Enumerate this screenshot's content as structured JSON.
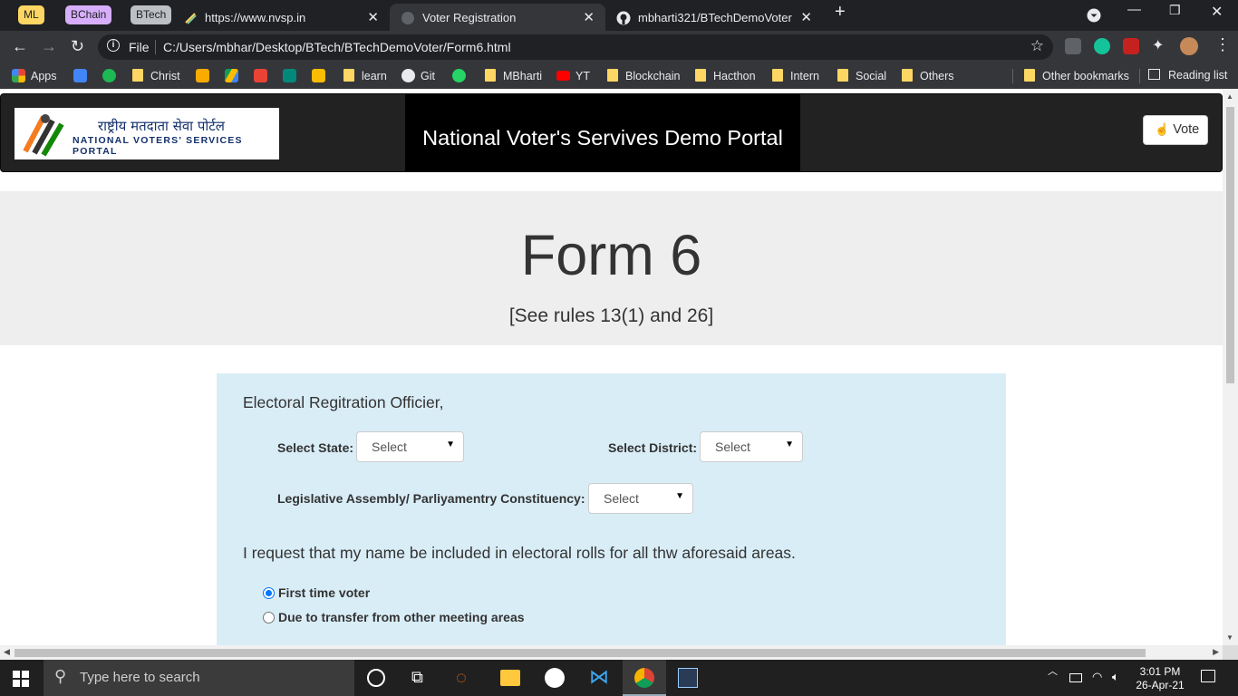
{
  "browser": {
    "tab_groups": [
      {
        "label": "ML",
        "color": "#fdd663"
      },
      {
        "label": "BChain",
        "color": "#d7aefb"
      },
      {
        "label": "BTech",
        "color": "#bdc1c6"
      }
    ],
    "tabs": [
      {
        "title": "https://www.nvsp.in"
      },
      {
        "title": "Voter Registration"
      },
      {
        "title": "mbharti321/BTechDemoVoter"
      }
    ],
    "new_tab": "+",
    "address": {
      "scheme_label": "File",
      "url": "C:/Users/mbhar/Desktop/BTech/BTechDemoVoter/Form6.html"
    },
    "bookmarks": [
      {
        "label": "Apps",
        "icon": "apps-grid-icon"
      },
      {
        "label": "Christ",
        "icon": "folder-icon"
      },
      {
        "label": "learn",
        "icon": "folder-icon"
      },
      {
        "label": "Git",
        "icon": "github-icon"
      },
      {
        "label": "MBharti",
        "icon": "folder-icon"
      },
      {
        "label": "YT",
        "icon": "youtube-icon"
      },
      {
        "label": "Blockchain",
        "icon": "folder-icon"
      },
      {
        "label": "Hacthon",
        "icon": "folder-icon"
      },
      {
        "label": "Intern",
        "icon": "folder-icon"
      },
      {
        "label": "Social",
        "icon": "folder-icon"
      },
      {
        "label": "Others",
        "icon": "folder-icon"
      },
      {
        "label": "Other bookmarks",
        "icon": "folder-icon"
      },
      {
        "label": "Reading list",
        "icon": "reading-list-icon"
      }
    ]
  },
  "page": {
    "logo": {
      "hindi": "राष्ट्रीय मतदाता सेवा पोर्टल",
      "english": "NATIONAL VOTERS' SERVICES PORTAL"
    },
    "brand_title": "National Voter's Servives Demo Portal",
    "vote_button": "Vote",
    "jumbotron": {
      "title": "Form 6",
      "subtitle": "[See rules 13(1) and 26]"
    },
    "form": {
      "greeting": "Electoral Regitration Officier,",
      "state_label": "Select State:",
      "state_value": "Select",
      "district_label": "Select District:",
      "district_value": "Select",
      "constituency_label": "Legislative Assembly/ Parliyamentry Constituency:",
      "constituency_value": "Select",
      "request_text": "I request that my name be included in electoral rolls for all thw aforesaid areas.",
      "options": [
        {
          "label": "First time voter",
          "checked": true
        },
        {
          "label": "Due to transfer from other meeting areas",
          "checked": false
        }
      ]
    }
  },
  "taskbar": {
    "search_placeholder": "Type here to search",
    "time": "3:01 PM",
    "date": "26-Apr-21"
  }
}
